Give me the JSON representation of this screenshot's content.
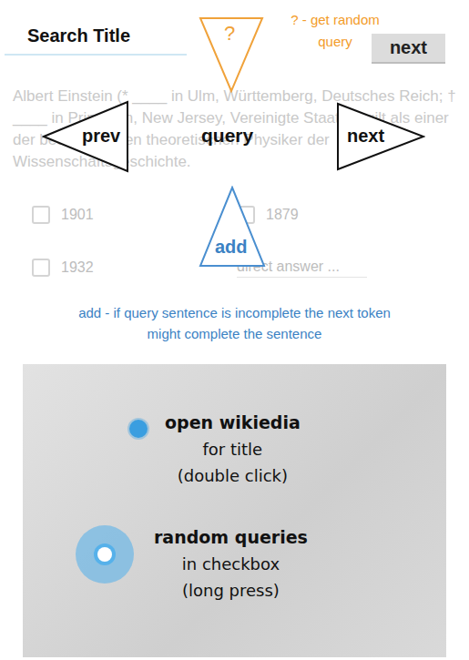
{
  "search": {
    "label": "Search Title"
  },
  "next_button": "next",
  "article": {
    "text": "Albert Einstein (* ____ in Ulm, Württemberg, Deutsches Reich; † ____ in Princeton, New Jersey, Vereinigte Staaten) gilt als einer der bedeutendsten theoretischen Physiker der Wissenschaftsgeschichte."
  },
  "answers": [
    {
      "label": "1901",
      "kind": "checkbox",
      "checked": false
    },
    {
      "label": "1879",
      "kind": "checkbox",
      "checked": false
    },
    {
      "label": "1932",
      "kind": "checkbox",
      "checked": false
    },
    {
      "label": "direct answer ...",
      "kind": "input",
      "checked": false
    }
  ],
  "tutorial": {
    "random_symbol": "?",
    "random_hint": "? - get random query",
    "prev": "prev",
    "query": "query",
    "next": "next",
    "add": "add",
    "add_hint": "add - if query sentence is incomplete the next token might complete the sentence"
  },
  "photo_hints": [
    {
      "kind": "dot",
      "title": "open wikiedia",
      "lines": [
        "for title",
        "(double click)"
      ]
    },
    {
      "kind": "press",
      "title": "random queries",
      "lines": [
        "in checkbox",
        "(long press)"
      ]
    }
  ]
}
